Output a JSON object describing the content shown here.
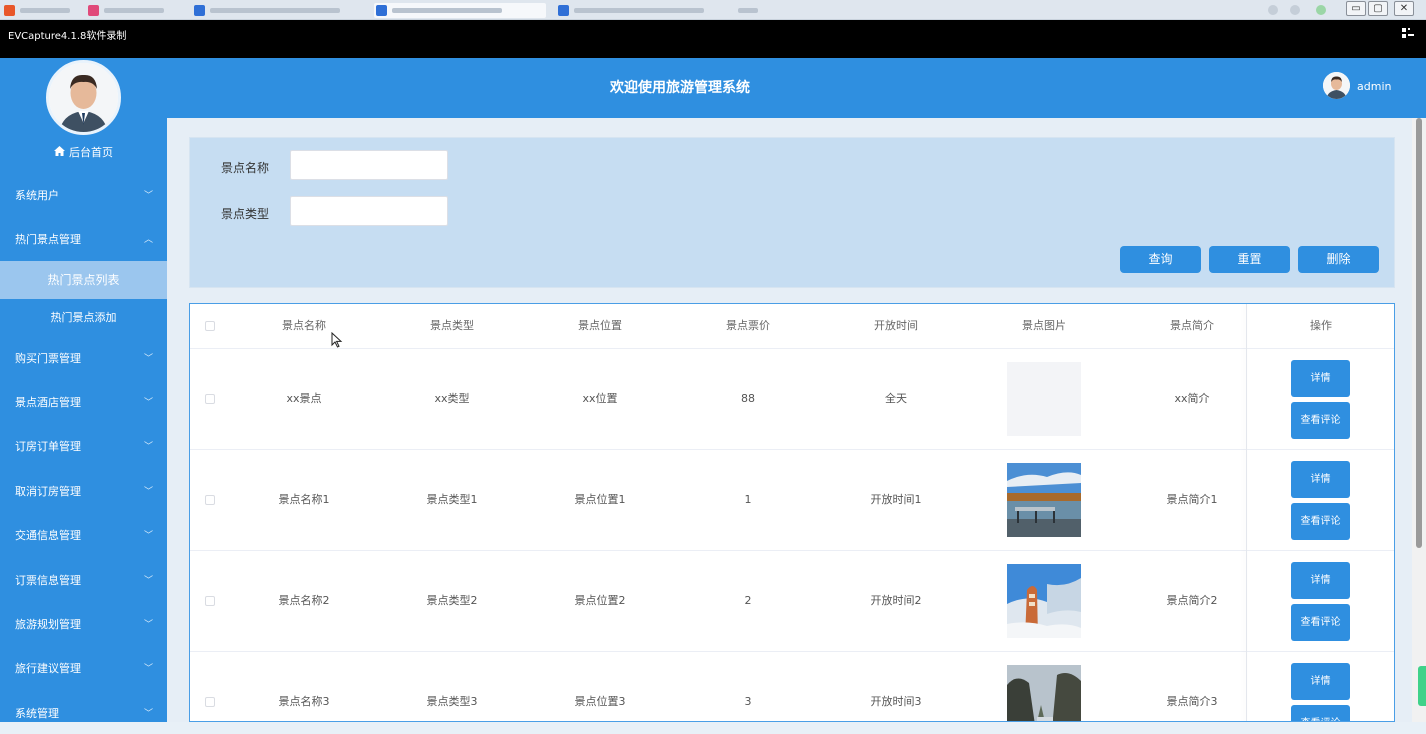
{
  "recorder": {
    "title": "EVCapture4.1.8软件录制",
    "grid_icon": "grid-icon"
  },
  "window": {
    "minimize": "▭",
    "maximize": "▢",
    "close": "✕"
  },
  "header": {
    "title": "欢迎使用旅游管理系统",
    "user_name": "admin"
  },
  "sidebar": {
    "home_label": "后台首页",
    "menus": [
      {
        "label": "系统用户",
        "expanded": false
      },
      {
        "label": "热门景点管理",
        "expanded": true
      },
      {
        "label": "购买门票管理",
        "expanded": false
      },
      {
        "label": "景点酒店管理",
        "expanded": false
      },
      {
        "label": "订房订单管理",
        "expanded": false
      },
      {
        "label": "取消订房管理",
        "expanded": false
      },
      {
        "label": "交通信息管理",
        "expanded": false
      },
      {
        "label": "订票信息管理",
        "expanded": false
      },
      {
        "label": "旅游规划管理",
        "expanded": false
      },
      {
        "label": "旅行建议管理",
        "expanded": false
      },
      {
        "label": "系统管理",
        "expanded": false
      }
    ],
    "sub_items": [
      {
        "label": "热门景点列表",
        "active": true
      },
      {
        "label": "热门景点添加",
        "active": false
      }
    ]
  },
  "search": {
    "name_label": "景点名称",
    "name_value": "",
    "type_label": "景点类型",
    "type_value": "",
    "query_button": "查询",
    "reset_button": "重置",
    "delete_button": "删除"
  },
  "table": {
    "headers": [
      "景点名称",
      "景点类型",
      "景点位置",
      "景点票价",
      "开放时间",
      "景点图片",
      "景点简介",
      "操作"
    ],
    "detail_button": "详情",
    "comments_button": "查看评论",
    "rows": [
      {
        "name": "xx景点",
        "type": "xx类型",
        "location": "xx位置",
        "price": "88",
        "open_time": "全天",
        "intro": "xx简介",
        "image": "blank-image"
      },
      {
        "name": "景点名称1",
        "type": "景点类型1",
        "location": "景点位置1",
        "price": "1",
        "open_time": "开放时间1",
        "intro": "景点简介1",
        "image": "lake-pier-photo"
      },
      {
        "name": "景点名称2",
        "type": "景点类型2",
        "location": "景点位置2",
        "price": "2",
        "open_time": "开放时间2",
        "intro": "景点简介2",
        "image": "frost-stone-photo"
      },
      {
        "name": "景点名称3",
        "type": "景点类型3",
        "location": "景点位置3",
        "price": "3",
        "open_time": "开放时间3",
        "intro": "景点简介3",
        "image": "mountain-cliff-photo"
      }
    ]
  },
  "colors": {
    "primary": "#2f8fe0",
    "sidebar_active": "#9bc6ee",
    "search_panel": "#c6ddf2"
  }
}
